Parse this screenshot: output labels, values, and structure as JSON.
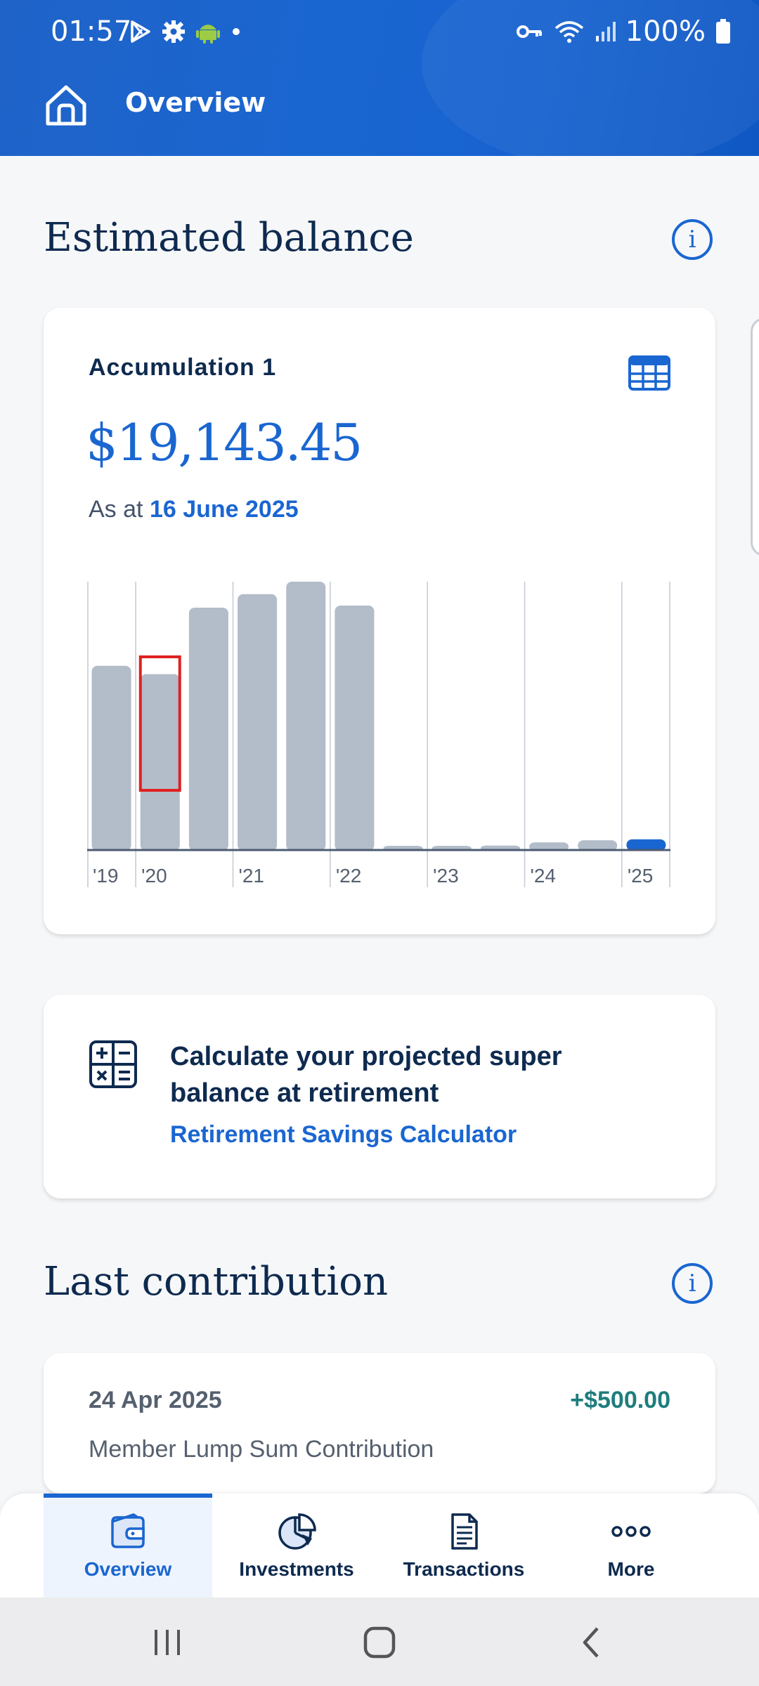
{
  "status_bar": {
    "time": "01:57",
    "battery": "100%"
  },
  "header": {
    "title": "Overview"
  },
  "estimated_balance": {
    "title": "Estimated balance",
    "account_label": "Accumulation 1",
    "amount": "$19,143.45",
    "as_at_prefix": "As at",
    "as_at_date": "16 June 2025"
  },
  "chart_data": {
    "type": "bar",
    "categories": [
      "'19 H2",
      "'20 H1",
      "'20 H2",
      "'21 H1",
      "'21 H2",
      "'22 H1",
      "'22 H2",
      "'23 H1",
      "'23 H2",
      "'24 H1",
      "'24 H2",
      "'25 H1"
    ],
    "values": [
      17600,
      16800,
      23200,
      24500,
      25700,
      23400,
      200,
      250,
      300,
      600,
      800,
      900
    ],
    "tick_labels": [
      "'19",
      "'20",
      "'21",
      "'22",
      "'23",
      "'24",
      "'25"
    ],
    "highlight_index": 11,
    "colors": {
      "bar": "#b3bcc9",
      "highlight": "#1a66d1",
      "selection": "#e02020"
    }
  },
  "calculator_card": {
    "text": "Calculate your projected super balance at retirement",
    "link": "Retirement Savings Calculator"
  },
  "last_contribution": {
    "title": "Last contribution",
    "date": "24 Apr 2025",
    "amount": "+$500.00",
    "description": "Member Lump Sum Contribution"
  },
  "bottom_nav": {
    "items": [
      {
        "label": "Overview",
        "icon": "wallet-icon"
      },
      {
        "label": "Investments",
        "icon": "pie-chart-icon"
      },
      {
        "label": "Transactions",
        "icon": "document-icon"
      },
      {
        "label": "More",
        "icon": "more-dots-icon"
      }
    ]
  }
}
